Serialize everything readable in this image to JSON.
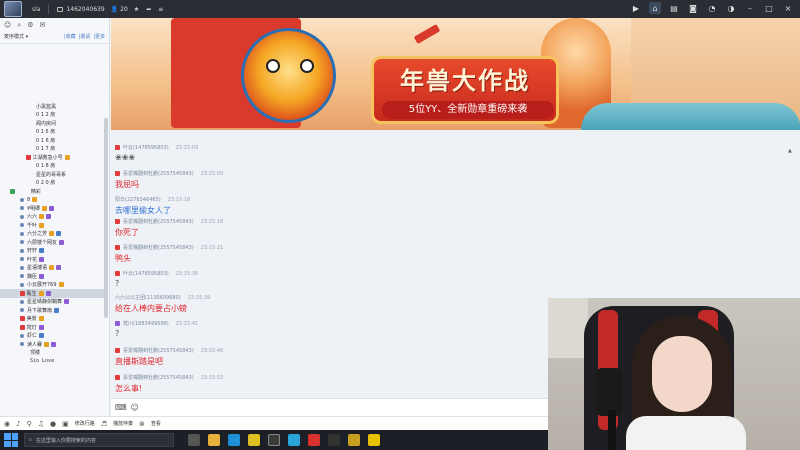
{
  "titlebar": {
    "username": "sla",
    "channel_id": "1462040639",
    "online_count": "20",
    "icons": [
      "star-icon",
      "share-icon",
      "menu-icon"
    ]
  },
  "left_panel": {
    "mode_label": "麦序模式 ▾",
    "links": [
      "|收藏",
      "|邀请",
      "|更多"
    ],
    "tree": [
      "小黑蓝黑",
      "0 1 2 房",
      "阁内房间",
      "0 1 5 房",
      "0 1 6 房",
      "0 1 7 房",
      "江湖救急小号",
      "0 1 8 房",
      "星星的哥哥系",
      "0 2 0 房",
      "精彩",
      "8",
      "¥明卿",
      "六六",
      "千叶",
      "六分之芳",
      "六层楼个网友",
      "轩轩",
      "叶花",
      "星语博语",
      "魏臣",
      "小云展开769",
      "甄生",
      "星星晴静剑鞘舞",
      "月下歌舞扇",
      "美景",
      "梵灯",
      "虾仁",
      "读人賽",
      "顶楼",
      "Sio Love"
    ]
  },
  "banner": {
    "title": "年兽大作战",
    "subtitle": "5位YY、全新勋章重磅来袭"
  },
  "chat": {
    "messages": [
      {
        "name": "叶云(1478595803)",
        "time": "23:15:03",
        "text": "❀❀❀",
        "style": "grey"
      },
      {
        "name": "喜爱嘴翻到杜鹏(2557545843)",
        "time": "23:15:09",
        "text": "我屈吗",
        "style": "red"
      },
      {
        "name": "阳日(2276346465)",
        "time": "23:15:18",
        "text": "去哪里偷女人了",
        "style": "blue"
      },
      {
        "name": "喜爱嘴翻到杜鹏(2557545843)",
        "time": "23:15:18",
        "text": "你死了",
        "style": "red"
      },
      {
        "name": "喜爱嘴翻到杜鹏(2557545843)",
        "time": "23:15:21",
        "text": "鸭头",
        "style": "red"
      },
      {
        "name": "叶云(1478595803)",
        "time": "23:15:36",
        "text": "?",
        "style": "grey"
      },
      {
        "name": "六六公公主团(1130609680)",
        "time": "23:15:39",
        "text": "给在人棒内要占小螃",
        "style": "red"
      },
      {
        "name": "梵川(1883499598)",
        "time": "23:15:41",
        "text": "?",
        "style": "grey"
      },
      {
        "name": "喜爱嘴翻到杜鹏(2557545843)",
        "time": "23:15:48",
        "text": "直播斯踏是吧",
        "style": "red"
      },
      {
        "name": "喜爱嘴翻到杜鹏(2557545843)",
        "time": "23:15:53",
        "text": "怎么事!",
        "style": "red"
      }
    ]
  },
  "input": {
    "placeholder": ""
  },
  "bottombar": {
    "items": [
      "申请",
      "请开麦",
      "接收",
      "语音",
      "播放",
      "弹幕",
      "修改行路",
      "播放伴奏",
      "查看"
    ]
  },
  "taskbar": {
    "search_placeholder": "在这里输入你要搜索的内容"
  }
}
